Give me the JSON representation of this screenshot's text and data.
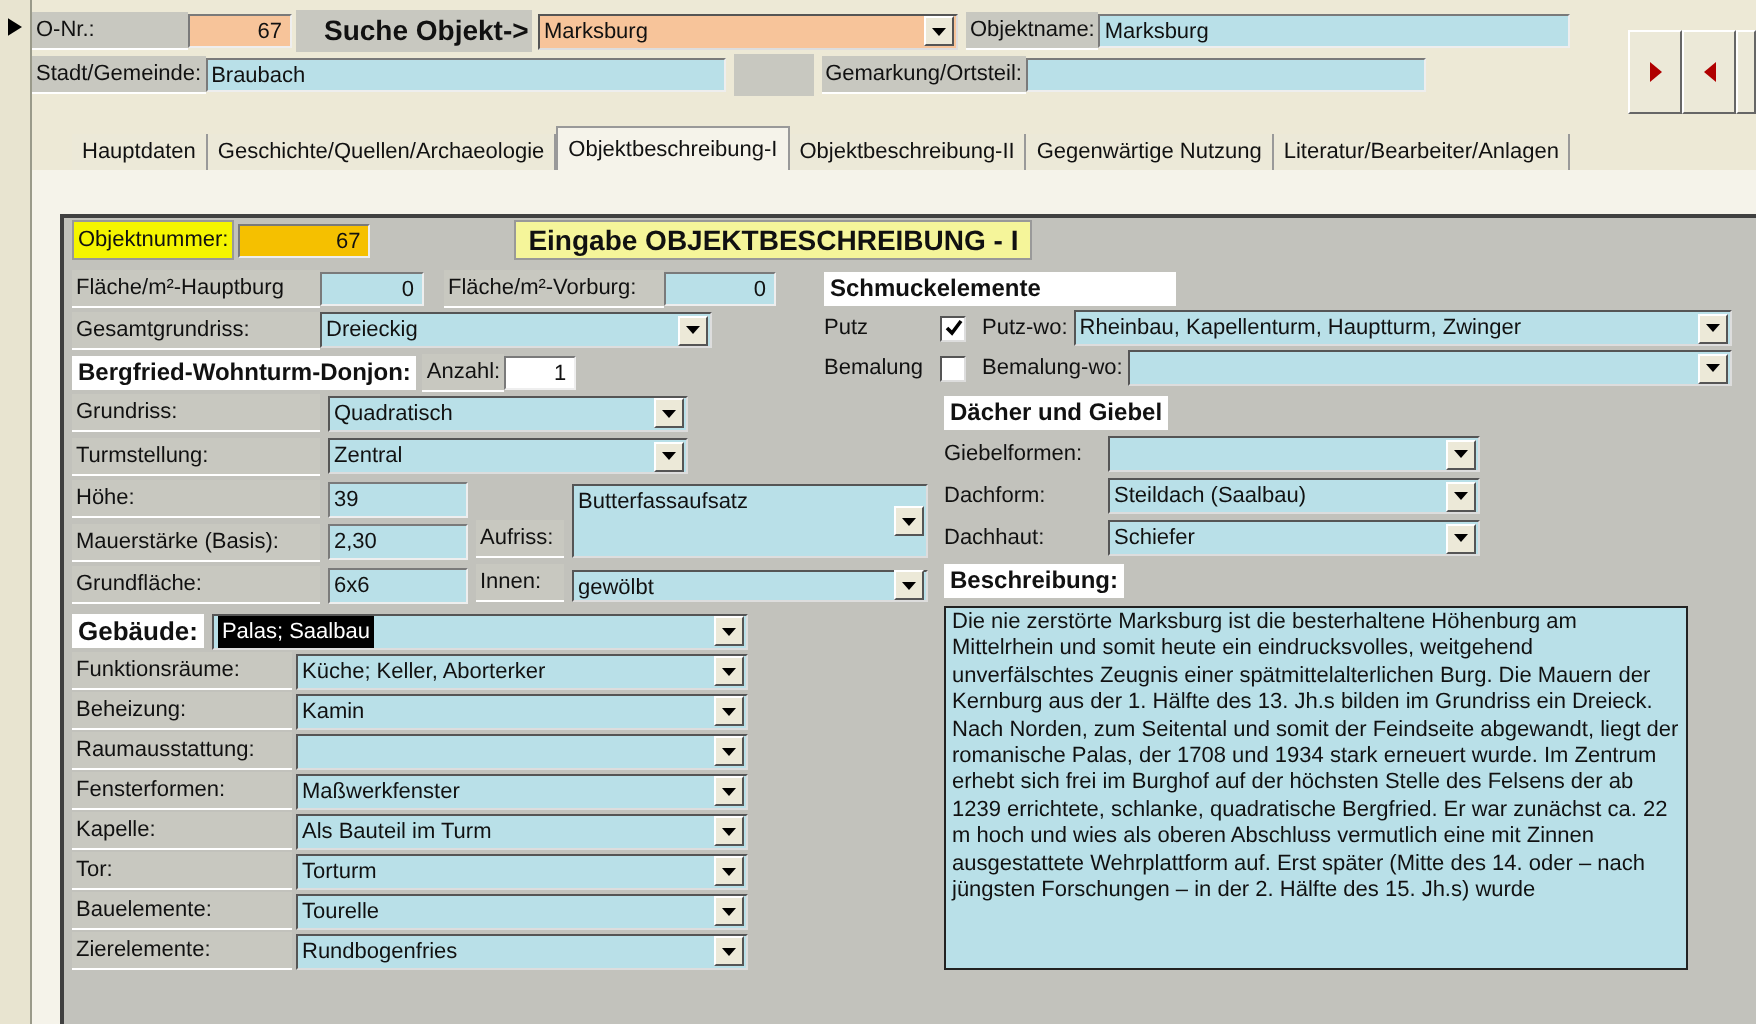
{
  "header": {
    "o_nr": {
      "label": "O-Nr.:",
      "value": "67"
    },
    "search_label": "Suche Objekt->",
    "search_value": "Marksburg",
    "objektname": {
      "label": "Objektname:",
      "value": "Marksburg"
    },
    "stadt": {
      "label": "Stadt/Gemeinde:",
      "value": "Braubach"
    },
    "gemarkung": {
      "label": "Gemarkung/Ortsteil:"
    }
  },
  "tabs": [
    {
      "label": "Hauptdaten",
      "selected": false
    },
    {
      "label": "Geschichte/Quellen/Archaeologie",
      "selected": false
    },
    {
      "label": "Objektbeschreibung-I",
      "selected": true
    },
    {
      "label": "Objektbeschreibung-II",
      "selected": false
    },
    {
      "label": "Gegenwärtige Nutzung",
      "selected": false
    },
    {
      "label": "Literatur/Bearbeiter/Anlagen",
      "selected": false
    }
  ],
  "form": {
    "objektnummer": {
      "label": "Objektnummer:",
      "value": "67"
    },
    "title": "Eingabe OBJEKTBESCHREIBUNG - I",
    "flaeche_hauptburg": {
      "label": "Fläche/m²-Hauptburg",
      "value": "0"
    },
    "flaeche_vorburg": {
      "label": "Fläche/m²-Vorburg:",
      "value": "0"
    },
    "gesamtgrundriss": {
      "label": "Gesamtgrundriss:",
      "value": "Dreieckig"
    },
    "bergfried": {
      "heading": "Bergfried-Wohnturm-Donjon:",
      "anzahl": {
        "label": "Anzahl:",
        "value": "1"
      },
      "fields": [
        {
          "label": "Grundriss:",
          "value": "Quadratisch",
          "kind": "combo"
        },
        {
          "label": "Turmstellung:",
          "value": "Zentral",
          "kind": "combo"
        },
        {
          "label": "Höhe:",
          "value": "39",
          "kind": "text"
        },
        {
          "label": "Mauerstärke (Basis):",
          "value": "2,30",
          "kind": "text"
        },
        {
          "label": "Grundfläche:",
          "value": "6x6",
          "kind": "text"
        }
      ],
      "aufriss": {
        "label": "Aufriss:",
        "value": "Butterfassaufsatz"
      },
      "innen": {
        "label": "Innen:",
        "value": "gewölbt"
      }
    },
    "schmuck": {
      "heading": "Schmuckelemente",
      "items": [
        {
          "label": "Putz",
          "checked": true,
          "where_label": "Putz-wo:",
          "where_value": "Rheinbau, Kapellenturm, Hauptturm, Zwinger"
        },
        {
          "label": "Bemalung",
          "checked": false,
          "where_label": "Bemalung-wo:"
        }
      ]
    },
    "gebaeude": {
      "heading": "Gebäude:",
      "value": "Palas; Saalbau",
      "text_selected": true,
      "fields": [
        {
          "label": "Funktionsräume:",
          "value": "Küche; Keller, Aborterker"
        },
        {
          "label": "Beheizung:",
          "value": "Kamin"
        },
        {
          "label": "Raumausstattung:"
        },
        {
          "label": "Fensterformen:",
          "value": "Maßwerkfenster"
        },
        {
          "label": "Kapelle:",
          "value": "Als Bauteil im Turm"
        },
        {
          "label": "Tor:",
          "value": "Torturm"
        },
        {
          "label": "Bauelemente:",
          "value": "Tourelle"
        },
        {
          "label": "Zierelemente:",
          "value": "Rundbogenfries"
        }
      ]
    },
    "daecher": {
      "heading": "Dächer und Giebel",
      "fields": [
        {
          "label": "Giebelformen:"
        },
        {
          "label": "Dachform:",
          "value": "Steildach (Saalbau)"
        },
        {
          "label": "Dachhaut:",
          "value": "Schiefer"
        }
      ]
    },
    "beschreibung": {
      "heading": "Beschreibung:",
      "text": "Die nie zerstörte Marksburg ist die besterhaltene Höhenburg am Mittelrhein und somit heute ein eindrucksvolles, weitgehend unverfälschtes Zeugnis einer spätmittelalterlichen Burg. Die Mauern der Kernburg aus der 1. Hälfte des 13. Jh.s bilden im Grundriss ein Dreieck. Nach Norden, zum Seitental und somit der Feindseite abgewandt, liegt der romanische Palas, der 1708 und 1934 stark erneuert wurde. Im Zentrum erhebt sich frei im Burghof auf der höchsten Stelle des Felsens der ab 1239 errichtete, schlanke, quadratische Bergfried. Er war zunächst ca. 22 m hoch und wies als oberen Abschluss vermutlich eine mit Zinnen ausgestattete Wehrplattform auf. Erst später (Mitte des 14. oder – nach jüngsten Forschungen – in der 2. Hälfte des 15. Jh.s) wurde"
    }
  }
}
